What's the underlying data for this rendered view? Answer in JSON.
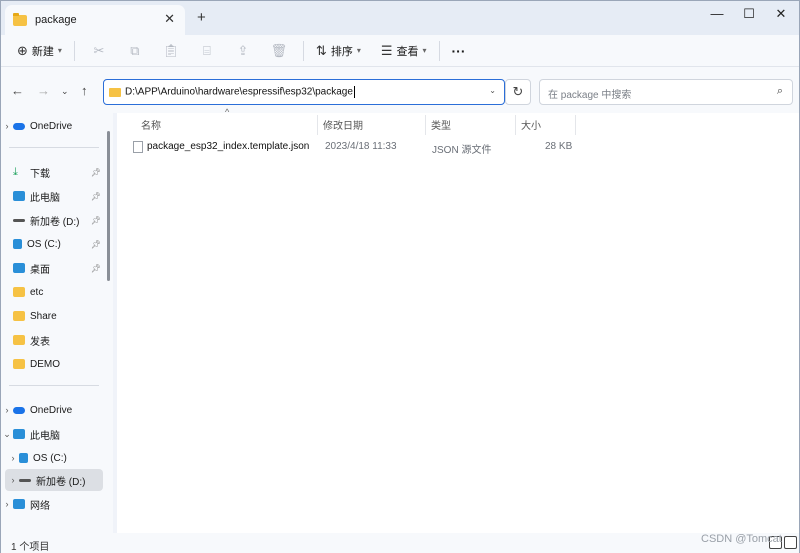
{
  "window": {
    "tab_title": "package",
    "tab_close": "✕",
    "new_tab": "+",
    "minimize": "—",
    "maximize": "☐",
    "close": "✕"
  },
  "toolbar": {
    "new_label": "新建",
    "sort_label": "排序",
    "view_label": "查看",
    "more_label": "···"
  },
  "address": {
    "path": "D:\\APP\\Arduino\\hardware\\espressif\\esp32\\package",
    "search_placeholder": "在 package 中搜索"
  },
  "sidebar": {
    "items": [
      {
        "label": "OneDrive",
        "icon": "cloud-icon",
        "color": "#1a73e8"
      },
      {
        "label": "下载",
        "icon": "download-icon",
        "color": "#1aa05a"
      },
      {
        "label": "此电脑",
        "icon": "computer-icon",
        "color": "#2a8fd8"
      },
      {
        "label": "新加卷 (D:)",
        "icon": "drive-icon",
        "color": "#555"
      },
      {
        "label": "OS (C:)",
        "icon": "windows-drive-icon",
        "color": "#2a8fd8"
      },
      {
        "label": "桌面",
        "icon": "desktop-icon",
        "color": "#2a8fd8"
      },
      {
        "label": "etc",
        "icon": "folder-icon",
        "color": "#f6c244"
      },
      {
        "label": "Share",
        "icon": "folder-icon",
        "color": "#f6c244"
      },
      {
        "label": "发表",
        "icon": "folder-icon",
        "color": "#f6c244"
      },
      {
        "label": "DEMO",
        "icon": "folder-icon",
        "color": "#f6c244"
      }
    ],
    "tree": [
      {
        "label": "OneDrive",
        "icon": "cloud-icon",
        "color": "#1a73e8"
      },
      {
        "label": "此电脑",
        "icon": "computer-icon",
        "color": "#2a8fd8"
      },
      {
        "label": "OS (C:)",
        "icon": "windows-drive-icon",
        "color": "#2a8fd8"
      },
      {
        "label": "新加卷 (D:)",
        "icon": "drive-icon",
        "color": "#555"
      },
      {
        "label": "网络",
        "icon": "network-icon",
        "color": "#2a8fd8"
      }
    ]
  },
  "columns": {
    "name": "名称",
    "modified": "修改日期",
    "type": "类型",
    "size": "大小"
  },
  "files": [
    {
      "name": "package_esp32_index.template.json",
      "modified": "2023/4/18 11:33",
      "type": "JSON 源文件",
      "size": "28 KB"
    }
  ],
  "status": {
    "count": "1 个项目"
  },
  "watermark": "CSDN @Tomcat"
}
